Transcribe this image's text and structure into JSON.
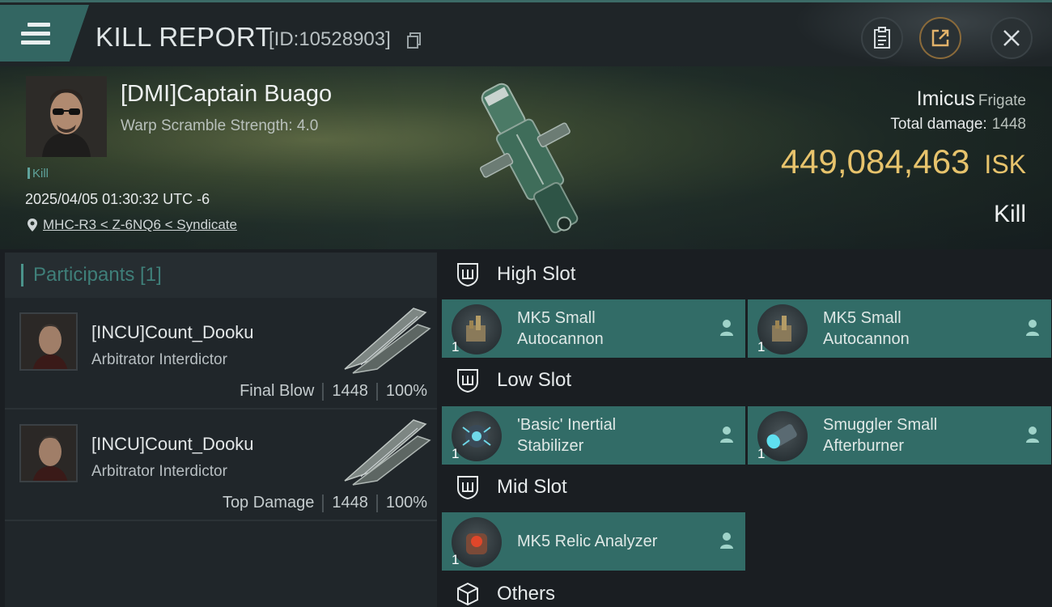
{
  "header": {
    "title": "KILL REPORT",
    "kill_id": "[ID:10528903]",
    "buttons": [
      "clipboard-icon",
      "share-icon",
      "close-icon"
    ]
  },
  "victim": {
    "name": "[DMI]Captain Buago",
    "warp_scramble": "Warp Scramble Strength: 4.0",
    "tag": "Kill",
    "timestamp": "2025/04/05 01:30:32 UTC -6",
    "location": "MHC-R3 < Z-6NQ6 < Syndicate",
    "ship_name": "Imicus",
    "ship_class": "Frigate",
    "total_damage_label": "Total damage:",
    "total_damage": "1448",
    "isk_value": "449,084,463",
    "isk_unit": "ISK",
    "kill_type": "Kill"
  },
  "participants": {
    "title": "Participants [1]",
    "rows": [
      {
        "name": "[INCU]Count_Dooku",
        "ship": "Arbitrator Interdictor",
        "role": "Final Blow",
        "damage": "1448",
        "percent": "100%"
      },
      {
        "name": "[INCU]Count_Dooku",
        "ship": "Arbitrator Interdictor",
        "role": "Top Damage",
        "damage": "1448",
        "percent": "100%"
      }
    ]
  },
  "fitting": {
    "high_slot": {
      "label": "High Slot",
      "modules": [
        {
          "name": "MK5 Small Autocannon",
          "line1": "MK5 Small",
          "line2": "Autocannon",
          "qty": "1"
        },
        {
          "name": "MK5 Small Autocannon",
          "line1": "MK5 Small",
          "line2": "Autocannon",
          "qty": "1"
        }
      ]
    },
    "low_slot": {
      "label": "Low Slot",
      "modules": [
        {
          "line1": "'Basic' Inertial",
          "line2": "Stabilizer",
          "qty": "1"
        },
        {
          "line1": "Smuggler Small",
          "line2": "Afterburner",
          "qty": "1"
        }
      ]
    },
    "mid_slot": {
      "label": "Mid Slot",
      "modules": [
        {
          "line1": "MK5 Relic Analyzer",
          "qty": "1"
        }
      ]
    },
    "others": {
      "label": "Others"
    }
  },
  "colors": {
    "accent_teal": "#326c67",
    "isk_gold": "#e7c36c",
    "header_bg": "#1f2528"
  }
}
